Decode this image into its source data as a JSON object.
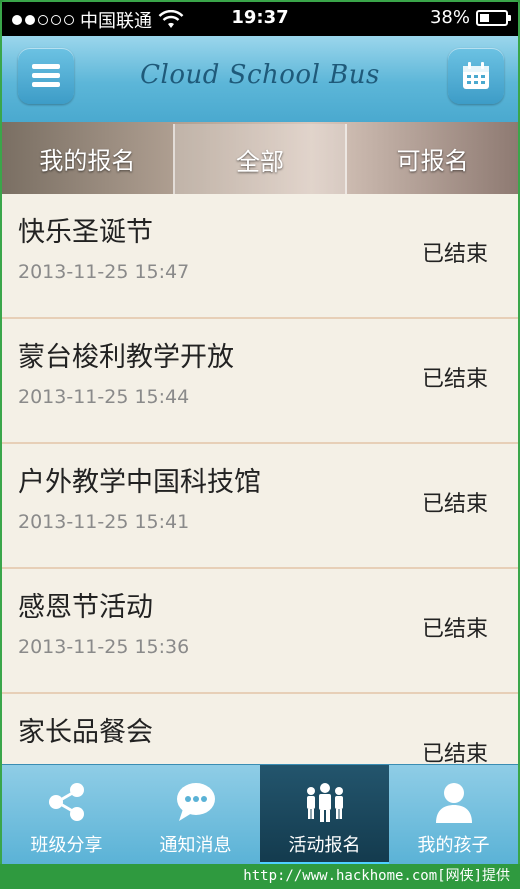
{
  "status_bar": {
    "carrier": "中国联通",
    "time": "19:37",
    "battery": "38%",
    "battery_level": 0.38,
    "signal_bars": 2,
    "signal_total": 5
  },
  "header": {
    "title": "Cloud School Bus",
    "menu_icon": "menu-icon",
    "calendar_icon": "calendar-icon"
  },
  "tabs": [
    {
      "label": "我的报名",
      "active": false
    },
    {
      "label": "全部",
      "active": true
    },
    {
      "label": "可报名",
      "active": false
    }
  ],
  "activities": [
    {
      "title": "快乐圣诞节",
      "date": "2013-11-25 15:47",
      "status": "已结束"
    },
    {
      "title": "蒙台梭利教学开放",
      "date": "2013-11-25 15:44",
      "status": "已结束"
    },
    {
      "title": "户外教学中国科技馆",
      "date": "2013-11-25 15:41",
      "status": "已结束"
    },
    {
      "title": "感恩节活动",
      "date": "2013-11-25 15:36",
      "status": "已结束"
    },
    {
      "title": "家长品餐会",
      "date": "",
      "status": "已结束"
    }
  ],
  "bottom_nav": [
    {
      "label": "班级分享",
      "icon": "share-icon",
      "active": false
    },
    {
      "label": "通知消息",
      "icon": "chat-bubble-icon",
      "active": false
    },
    {
      "label": "活动报名",
      "icon": "group-icon",
      "active": true
    },
    {
      "label": "我的孩子",
      "icon": "person-icon",
      "active": false
    }
  ],
  "watermark": "http://www.hackhome.com[网侠]提供"
}
